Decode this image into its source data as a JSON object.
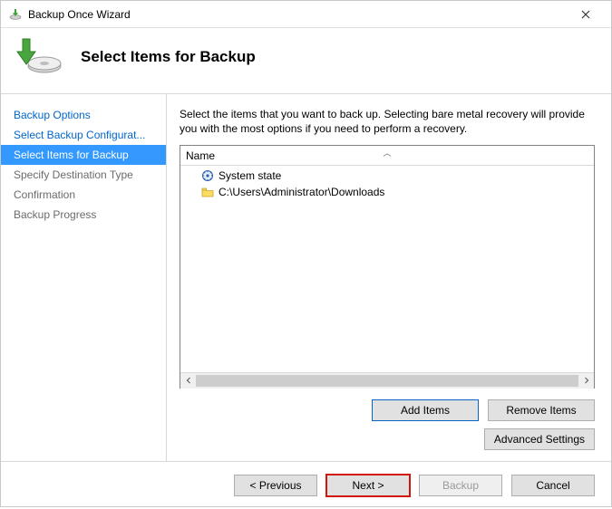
{
  "window": {
    "title": "Backup Once Wizard",
    "heading": "Select Items for Backup"
  },
  "sidebar": {
    "steps": [
      {
        "label": "Backup Options",
        "state": "link"
      },
      {
        "label": "Select Backup Configurat...",
        "state": "link"
      },
      {
        "label": "Select Items for Backup",
        "state": "active"
      },
      {
        "label": "Specify Destination Type",
        "state": "grey"
      },
      {
        "label": "Confirmation",
        "state": "grey"
      },
      {
        "label": "Backup Progress",
        "state": "grey"
      }
    ]
  },
  "main": {
    "instructions": "Select the items that you want to back up. Selecting bare metal recovery will provide you with the most options if you need to perform a recovery.",
    "column_header": "Name",
    "items": [
      {
        "icon": "system-state-icon",
        "label": "System state"
      },
      {
        "icon": "folder-icon",
        "label": "C:\\Users\\Administrator\\Downloads"
      }
    ],
    "buttons": {
      "add": "Add Items",
      "remove": "Remove Items",
      "advanced": "Advanced Settings"
    }
  },
  "footer": {
    "previous": "< Previous",
    "next": "Next >",
    "backup": "Backup",
    "cancel": "Cancel"
  }
}
